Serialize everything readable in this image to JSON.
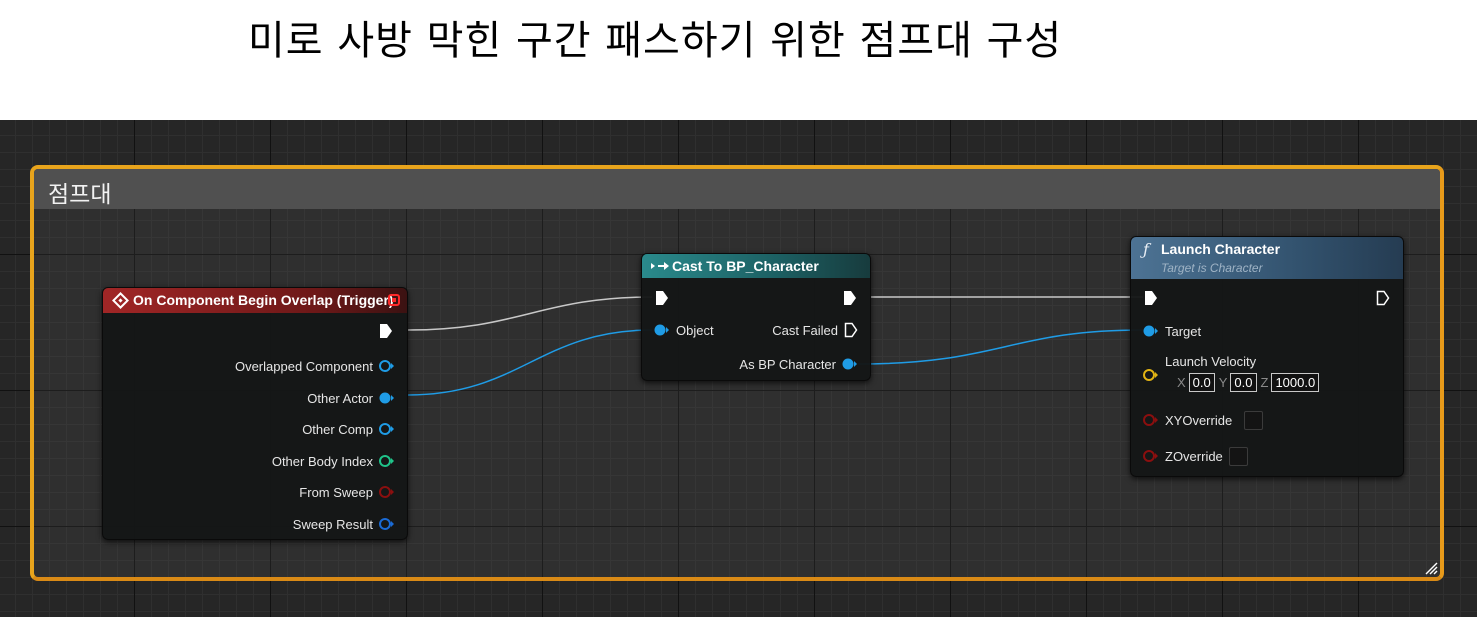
{
  "page_title": "미로 사방 막힌 구간 패스하기 위한 점프대 구성",
  "comment": {
    "title": "점프대"
  },
  "nodes": {
    "overlap": {
      "title": "On Component Begin Overlap (Trigger)",
      "pins": [
        "Overlapped Component",
        "Other Actor",
        "Other Comp",
        "Other Body Index",
        "From Sweep",
        "Sweep Result"
      ]
    },
    "cast": {
      "title": "Cast To BP_Character",
      "object_label": "Object",
      "cast_failed_label": "Cast Failed",
      "as_label": "As BP Character"
    },
    "launch": {
      "title": "Launch Character",
      "subtitle": "Target is Character",
      "target_label": "Target",
      "velocity_label": "Launch Velocity",
      "x_axis": "X",
      "y_axis": "Y",
      "z_axis": "Z",
      "x_value": "0.0",
      "y_value": "0.0",
      "z_value": "1000.0",
      "xy_override_label": "XYOverride",
      "z_override_label": "ZOverride"
    }
  },
  "colors": {
    "comment_border": "#e8a41c",
    "event_header": "#8c1d1d",
    "cast_header": "#1f6e70",
    "function_header": "#3a5b78",
    "object_pin": "#1f9ce6",
    "int_pin": "#1fc48a",
    "bool_pin": "#8b0f0f",
    "vector_pin": "#e2b414",
    "exec_wire": "#c8c8c8"
  }
}
